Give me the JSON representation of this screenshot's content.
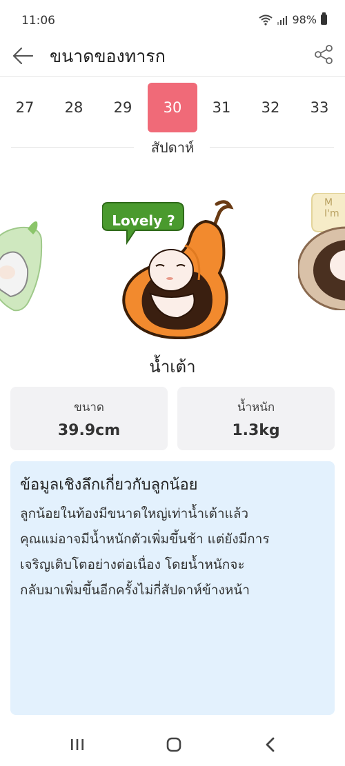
{
  "status_bar": {
    "time": "11:06",
    "battery": "98%"
  },
  "app_bar": {
    "title": "ขนาดของทารก"
  },
  "week_selector": {
    "weeks": [
      "27",
      "28",
      "29",
      "30",
      "31",
      "32",
      "33"
    ],
    "selected": "30",
    "label": "สัปดาห์"
  },
  "carousel": {
    "main_bubble": "Lovely ?",
    "right_bubble_partial": "M\nI'm",
    "fruit_name": "น้ำเต้า"
  },
  "stats": {
    "size_label": "ขนาด",
    "size_value": "39.9cm",
    "weight_label": "น้ำหนัก",
    "weight_value": "1.3kg"
  },
  "info": {
    "heading": "ข้อมูลเชิงลึกเกี่ยวกับลูกน้อย",
    "body_lines": [
      "ลูกน้อยในท้องมีขนาดใหญ่เท่าน้ำเต้าแล้ว",
      "คุณแม่อาจมีน้ำหนักตัวเพิ่มขึ้นช้า แต่ยังมีการ",
      "เจริญเติบโตอย่างต่อเนื่อง โดยน้ำหนักจะ",
      "กลับมาเพิ่มขึ้นอีกครั้งไม่กี่สัปดาห์ข้างหน้า"
    ]
  },
  "colors": {
    "accent": "#f06a78",
    "info_bg": "#e3f1fd",
    "stat_bg": "#f2f2f4",
    "gourd": "#f28a2e",
    "bubble": "#4a9a2e"
  },
  "icons": {
    "back": "arrow-left-icon",
    "share": "share-icon",
    "nav_recents": "recents-icon",
    "nav_home": "home-icon",
    "nav_back": "chevron-left-icon"
  }
}
